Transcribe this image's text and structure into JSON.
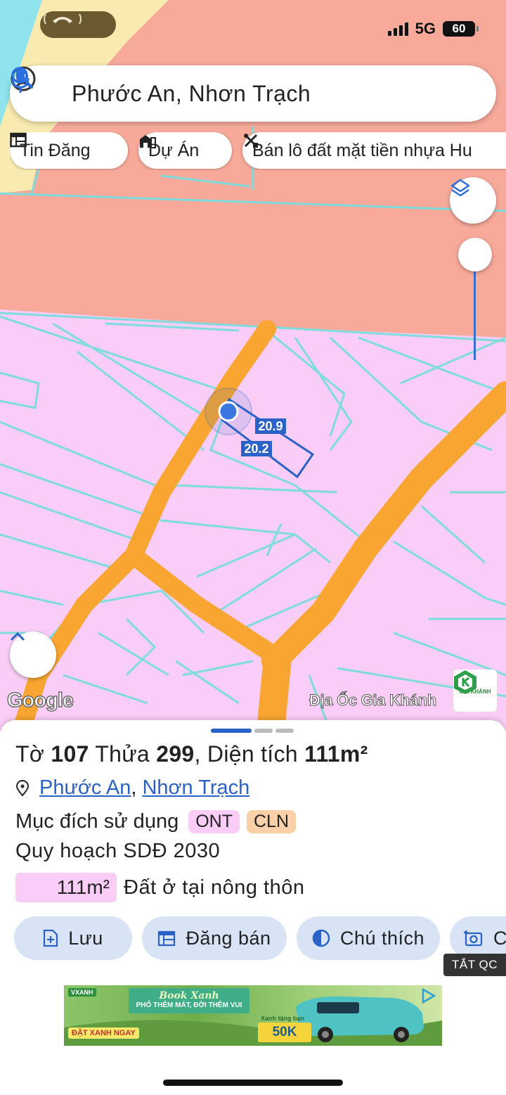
{
  "status_bar": {
    "network": "5G",
    "battery": "60"
  },
  "search": {
    "value": "Phước An, Nhơn Trạch"
  },
  "chips": [
    {
      "label": "Tin Đăng",
      "icon": "listing-icon"
    },
    {
      "label": "Dự Án",
      "icon": "buildings-icon"
    },
    {
      "label": "Bán lô đất mặt tiền nhựa Hu",
      "icon": "tools-icon"
    }
  ],
  "map": {
    "edge_labels": [
      "20.9",
      "20.2"
    ],
    "attribution": "Google",
    "brand_overlay": "Địa Ốc Gia Khánh",
    "brand_logo_text": "GIA KHÁNH",
    "colors": {
      "residential": "#f9cdf5",
      "agricultural": "#f7a99a",
      "road": "#f8a531",
      "parcel_line": "#7fdcdc",
      "water": "#8fe3ec",
      "yellow_zone": "#f9eab0",
      "selection": "#2a62c8"
    }
  },
  "sheet": {
    "title": {
      "prefix": "Tờ",
      "to_number": "107",
      "mid": "Thửa",
      "thua_number": "299",
      "area_label": ", Diện tích",
      "area_value": "111m²"
    },
    "location": {
      "ward": "Phước An",
      "separator": ",",
      "district": "Nhơn Trạch"
    },
    "land_use": {
      "label": "Mục đích sử dụng",
      "badges": [
        {
          "code": "ONT",
          "color": "#f9cdf5"
        },
        {
          "code": "CLN",
          "color": "#f9d0a8"
        }
      ]
    },
    "plan_label": "Quy hoạch SDĐ 2030",
    "plan_area": {
      "value": "111m²",
      "description": "Đất ở tại nông thôn",
      "color": "#f9cdf5"
    },
    "actions": [
      {
        "label": "Lưu",
        "icon": "save-icon"
      },
      {
        "label": "Đăng bán",
        "icon": "calendar-icon"
      },
      {
        "label": "Chú thích",
        "icon": "legend-icon"
      },
      {
        "label": "C",
        "icon": "camera-icon"
      }
    ],
    "ad_toggle": "TẮT QC"
  },
  "ad": {
    "tag": "VXANH",
    "headline": "Book Xanh",
    "subline": "PHỐ THÊM MÁT, ĐỜI THÊM VUI",
    "cta": "ĐẶT XANH NGAY",
    "bonus_label": "Xanh tặng bạn",
    "bonus": "50K"
  }
}
